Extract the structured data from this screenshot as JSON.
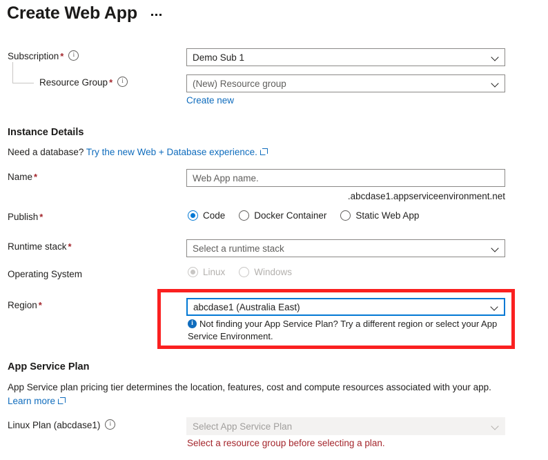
{
  "header": {
    "title": "Create Web App",
    "more_menu": "…"
  },
  "basics": {
    "subscription": {
      "label": "Subscription",
      "required": "*",
      "info_icon": "info-circle-icon",
      "value": "Demo Sub 1"
    },
    "resource_group": {
      "label": "Resource Group",
      "required": "*",
      "info_icon": "info-circle-icon",
      "value": "(New) Resource group",
      "create_new_link": "Create new"
    }
  },
  "instance_details": {
    "heading": "Instance Details",
    "database_prompt": "Need a database? ",
    "database_link": "Try the new Web + Database experience.",
    "name": {
      "label": "Name",
      "required": "*",
      "placeholder": "Web App name.",
      "value": "",
      "suffix": ".abcdase1.appserviceenvironment.net"
    },
    "publish": {
      "label": "Publish",
      "required": "*",
      "options": [
        {
          "label": "Code",
          "checked": true
        },
        {
          "label": "Docker Container",
          "checked": false
        },
        {
          "label": "Static Web App",
          "checked": false
        }
      ]
    },
    "runtime_stack": {
      "label": "Runtime stack",
      "required": "*",
      "value": "Select a runtime stack"
    },
    "operating_system": {
      "label": "Operating System",
      "required": "",
      "disabled": true,
      "options": [
        {
          "label": "Linux",
          "checked": true
        },
        {
          "label": "Windows",
          "checked": false
        }
      ]
    },
    "region": {
      "label": "Region",
      "required": "*",
      "value": "abcdase1 (Australia East)",
      "info_message": "Not finding your App Service Plan? Try a different region or select your App Service Environment."
    }
  },
  "app_service_plan": {
    "heading": "App Service Plan",
    "description": "App Service plan pricing tier determines the location, features, cost and compute resources associated with your app.",
    "learn_more": "Learn more",
    "plan": {
      "label": "Linux Plan (abcdase1)",
      "info_icon": "info-circle-icon",
      "placeholder": "Select App Service Plan",
      "error": "Select a resource group before selecting a plan."
    }
  },
  "colors": {
    "accent": "#0078d4",
    "link": "#0f6cbd",
    "required": "#a4262c",
    "error": "#a4262c",
    "annotation": "#fa2020"
  }
}
